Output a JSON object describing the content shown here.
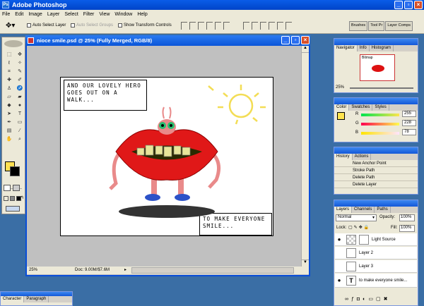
{
  "app": {
    "title": "Adobe Photoshop",
    "icon": "Ps"
  },
  "menu": [
    "File",
    "Edit",
    "Image",
    "Layer",
    "Select",
    "Filter",
    "View",
    "Window",
    "Help"
  ],
  "options": {
    "auto_select_layer": "Auto Select Layer",
    "auto_select_groups": "Auto Select Groups",
    "show_transform": "Show Transform Controls"
  },
  "dock_tabs": [
    "Brushes",
    "Tool Pr",
    "Layer Comps"
  ],
  "document": {
    "title": "nioce smile.psd @ 25% (Fully Merged, RGB/8)",
    "zoom": "25%",
    "doc_size": "Doc: 9.00M/$7.6M",
    "caption_top": "AND OUR LOVELY HERO GOES OUT ON A WALK...",
    "caption_bottom": "TO MAKE EVERYONE SMILE..."
  },
  "navigator": {
    "tabs": [
      "Navigator",
      "Info",
      "Histogram"
    ],
    "zoom": "25%",
    "label": "Bitmap"
  },
  "color": {
    "tabs": [
      "Color",
      "Swatches",
      "Styles"
    ],
    "r": "255",
    "g": "228",
    "b": "78",
    "r_label": "R",
    "g_label": "G",
    "b_label": "B",
    "fg_hex": "#ffe44e"
  },
  "history": {
    "tabs": [
      "History",
      "Actions"
    ],
    "items": [
      "New Anchor Point",
      "Stroke Path",
      "Delete Path",
      "Delete Layer"
    ]
  },
  "layers": {
    "tabs": [
      "Layers",
      "Channels",
      "Paths"
    ],
    "blend": "Normal",
    "opacity_label": "Opacity:",
    "opacity": "100%",
    "lock_label": "Lock:",
    "fill_label": "Fill:",
    "fill": "100%",
    "rows": [
      {
        "name": "Light Source"
      },
      {
        "name": "Layer 2"
      },
      {
        "name": "Layer 3"
      },
      {
        "name": "to make everyone smile..."
      }
    ]
  },
  "bottom_tabs": [
    "Character",
    "Paragraph"
  ]
}
